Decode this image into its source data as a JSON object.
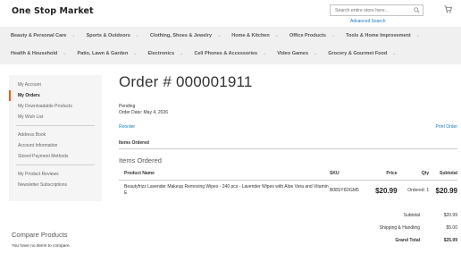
{
  "header": {
    "logo": "One Stop Market",
    "search_placeholder": "Search entire store here...",
    "advanced_search": "Advanced Search"
  },
  "nav": {
    "row1": [
      "Beauty & Personal Care",
      "Sports & Outdoors",
      "Clothing, Shoes & Jewelry",
      "Home & Kitchen",
      "Office Products",
      "Tools & Home Improvement"
    ],
    "row2": [
      "Health & Household",
      "Patio, Lawn & Garden",
      "Electronics",
      "Cell Phones & Accessories",
      "Video Games",
      "Grocery & Gourmet Food"
    ]
  },
  "sidebar": {
    "group1": [
      "My Account",
      "My Orders",
      "My Downloadable Products",
      "My Wish List"
    ],
    "group2": [
      "Address Book",
      "Account Information",
      "Stored Payment Methods"
    ],
    "group3": [
      "My Product Reviews",
      "Newsletter Subscriptions"
    ]
  },
  "compare": {
    "title": "Compare Products",
    "empty": "You have no items to compare."
  },
  "order": {
    "title": "Order # 000001911",
    "status": "Pending",
    "date": "Order Date: May 4, 2026",
    "reorder": "Reorder",
    "print": "Print Order",
    "tab": "Items Ordered",
    "section_heading": "Items Ordered",
    "columns": {
      "name": "Product Name",
      "sku": "SKU",
      "price": "Price",
      "qty": "Qty",
      "subtotal": "Subtotal"
    },
    "item": {
      "name": "Beautyfrizz Lavender Makeup Removing Wipes - 240 pcs - Lavender Wipes with Aloe Vera and Vitamin E",
      "sku": "B08SY6DGM5",
      "price": "$20.99",
      "qty": "Ordered: 1",
      "subtotal": "$20.99"
    },
    "totals": {
      "subtotal_label": "Subtotal",
      "subtotal": "$20.99",
      "shipping_label": "Shipping & Handling",
      "shipping": "$5.00",
      "grand_label": "Grand Total",
      "grand": "$25.99"
    }
  }
}
